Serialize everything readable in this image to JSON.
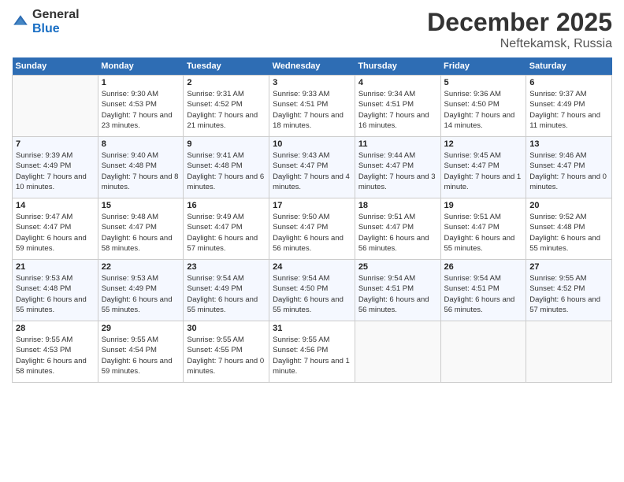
{
  "header": {
    "logo_general": "General",
    "logo_blue": "Blue",
    "month": "December 2025",
    "location": "Neftekamsk, Russia"
  },
  "weekdays": [
    "Sunday",
    "Monday",
    "Tuesday",
    "Wednesday",
    "Thursday",
    "Friday",
    "Saturday"
  ],
  "weeks": [
    [
      {
        "day": null
      },
      {
        "day": 1,
        "sunrise": "9:30 AM",
        "sunset": "4:53 PM",
        "daylight": "7 hours and 23 minutes."
      },
      {
        "day": 2,
        "sunrise": "9:31 AM",
        "sunset": "4:52 PM",
        "daylight": "7 hours and 21 minutes."
      },
      {
        "day": 3,
        "sunrise": "9:33 AM",
        "sunset": "4:51 PM",
        "daylight": "7 hours and 18 minutes."
      },
      {
        "day": 4,
        "sunrise": "9:34 AM",
        "sunset": "4:51 PM",
        "daylight": "7 hours and 16 minutes."
      },
      {
        "day": 5,
        "sunrise": "9:36 AM",
        "sunset": "4:50 PM",
        "daylight": "7 hours and 14 minutes."
      },
      {
        "day": 6,
        "sunrise": "9:37 AM",
        "sunset": "4:49 PM",
        "daylight": "7 hours and 11 minutes."
      }
    ],
    [
      {
        "day": 7,
        "sunrise": "9:39 AM",
        "sunset": "4:49 PM",
        "daylight": "7 hours and 10 minutes."
      },
      {
        "day": 8,
        "sunrise": "9:40 AM",
        "sunset": "4:48 PM",
        "daylight": "7 hours and 8 minutes."
      },
      {
        "day": 9,
        "sunrise": "9:41 AM",
        "sunset": "4:48 PM",
        "daylight": "7 hours and 6 minutes."
      },
      {
        "day": 10,
        "sunrise": "9:43 AM",
        "sunset": "4:47 PM",
        "daylight": "7 hours and 4 minutes."
      },
      {
        "day": 11,
        "sunrise": "9:44 AM",
        "sunset": "4:47 PM",
        "daylight": "7 hours and 3 minutes."
      },
      {
        "day": 12,
        "sunrise": "9:45 AM",
        "sunset": "4:47 PM",
        "daylight": "7 hours and 1 minute."
      },
      {
        "day": 13,
        "sunrise": "9:46 AM",
        "sunset": "4:47 PM",
        "daylight": "7 hours and 0 minutes."
      }
    ],
    [
      {
        "day": 14,
        "sunrise": "9:47 AM",
        "sunset": "4:47 PM",
        "daylight": "6 hours and 59 minutes."
      },
      {
        "day": 15,
        "sunrise": "9:48 AM",
        "sunset": "4:47 PM",
        "daylight": "6 hours and 58 minutes."
      },
      {
        "day": 16,
        "sunrise": "9:49 AM",
        "sunset": "4:47 PM",
        "daylight": "6 hours and 57 minutes."
      },
      {
        "day": 17,
        "sunrise": "9:50 AM",
        "sunset": "4:47 PM",
        "daylight": "6 hours and 56 minutes."
      },
      {
        "day": 18,
        "sunrise": "9:51 AM",
        "sunset": "4:47 PM",
        "daylight": "6 hours and 56 minutes."
      },
      {
        "day": 19,
        "sunrise": "9:51 AM",
        "sunset": "4:47 PM",
        "daylight": "6 hours and 55 minutes."
      },
      {
        "day": 20,
        "sunrise": "9:52 AM",
        "sunset": "4:48 PM",
        "daylight": "6 hours and 55 minutes."
      }
    ],
    [
      {
        "day": 21,
        "sunrise": "9:53 AM",
        "sunset": "4:48 PM",
        "daylight": "6 hours and 55 minutes."
      },
      {
        "day": 22,
        "sunrise": "9:53 AM",
        "sunset": "4:49 PM",
        "daylight": "6 hours and 55 minutes."
      },
      {
        "day": 23,
        "sunrise": "9:54 AM",
        "sunset": "4:49 PM",
        "daylight": "6 hours and 55 minutes."
      },
      {
        "day": 24,
        "sunrise": "9:54 AM",
        "sunset": "4:50 PM",
        "daylight": "6 hours and 55 minutes."
      },
      {
        "day": 25,
        "sunrise": "9:54 AM",
        "sunset": "4:51 PM",
        "daylight": "6 hours and 56 minutes."
      },
      {
        "day": 26,
        "sunrise": "9:54 AM",
        "sunset": "4:51 PM",
        "daylight": "6 hours and 56 minutes."
      },
      {
        "day": 27,
        "sunrise": "9:55 AM",
        "sunset": "4:52 PM",
        "daylight": "6 hours and 57 minutes."
      }
    ],
    [
      {
        "day": 28,
        "sunrise": "9:55 AM",
        "sunset": "4:53 PM",
        "daylight": "6 hours and 58 minutes."
      },
      {
        "day": 29,
        "sunrise": "9:55 AM",
        "sunset": "4:54 PM",
        "daylight": "6 hours and 59 minutes."
      },
      {
        "day": 30,
        "sunrise": "9:55 AM",
        "sunset": "4:55 PM",
        "daylight": "7 hours and 0 minutes."
      },
      {
        "day": 31,
        "sunrise": "9:55 AM",
        "sunset": "4:56 PM",
        "daylight": "7 hours and 1 minute."
      },
      {
        "day": null
      },
      {
        "day": null
      },
      {
        "day": null
      }
    ]
  ]
}
